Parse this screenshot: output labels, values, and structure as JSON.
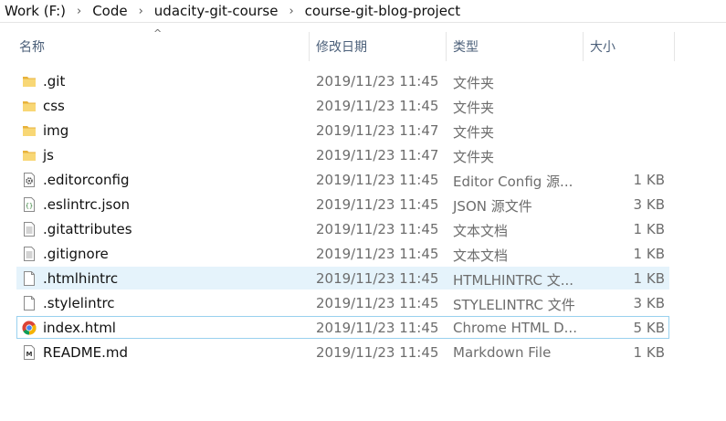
{
  "breadcrumb": [
    "Work (F:)",
    "Code",
    "udacity-git-course",
    "course-git-blog-project"
  ],
  "breadcrumb_separator": "›",
  "columns": {
    "name": "名称",
    "date": "修改日期",
    "type": "类型",
    "size": "大小"
  },
  "sort_indicator": "^",
  "files": [
    {
      "icon": "folder-icon",
      "name": ".git",
      "date": "2019/11/23 11:45",
      "type": "文件夹",
      "size": ""
    },
    {
      "icon": "folder-icon",
      "name": "css",
      "date": "2019/11/23 11:45",
      "type": "文件夹",
      "size": ""
    },
    {
      "icon": "folder-icon",
      "name": "img",
      "date": "2019/11/23 11:47",
      "type": "文件夹",
      "size": ""
    },
    {
      "icon": "folder-icon",
      "name": "js",
      "date": "2019/11/23 11:47",
      "type": "文件夹",
      "size": ""
    },
    {
      "icon": "gear-file-icon",
      "name": ".editorconfig",
      "date": "2019/11/23 11:45",
      "type": "Editor Config 源...",
      "size": "1 KB"
    },
    {
      "icon": "json-file-icon",
      "name": ".eslintrc.json",
      "date": "2019/11/23 11:45",
      "type": "JSON 源文件",
      "size": "3 KB"
    },
    {
      "icon": "text-file-icon",
      "name": ".gitattributes",
      "date": "2019/11/23 11:45",
      "type": "文本文档",
      "size": "1 KB"
    },
    {
      "icon": "text-file-icon",
      "name": ".gitignore",
      "date": "2019/11/23 11:45",
      "type": "文本文档",
      "size": "1 KB"
    },
    {
      "icon": "blank-file-icon",
      "name": ".htmlhintrc",
      "date": "2019/11/23 11:45",
      "type": "HTMLHINTRC 文...",
      "size": "1 KB"
    },
    {
      "icon": "blank-file-icon",
      "name": ".stylelintrc",
      "date": "2019/11/23 11:45",
      "type": "STYLELINTRC 文件",
      "size": "3 KB"
    },
    {
      "icon": "chrome-icon",
      "name": "index.html",
      "date": "2019/11/23 11:45",
      "type": "Chrome HTML D...",
      "size": "5 KB"
    },
    {
      "icon": "markdown-file-icon",
      "name": "README.md",
      "date": "2019/11/23 11:45",
      "type": "Markdown File",
      "size": "1 KB"
    }
  ],
  "hovered_file": ".htmlhintrc",
  "focused_file": "index.html",
  "colors": {
    "folder": "#f4c542",
    "hover_bg": "#e5f3fb",
    "focus_border": "#99d1ef",
    "header_text": "#4c607a",
    "meta_text": "#6d6d6d"
  }
}
